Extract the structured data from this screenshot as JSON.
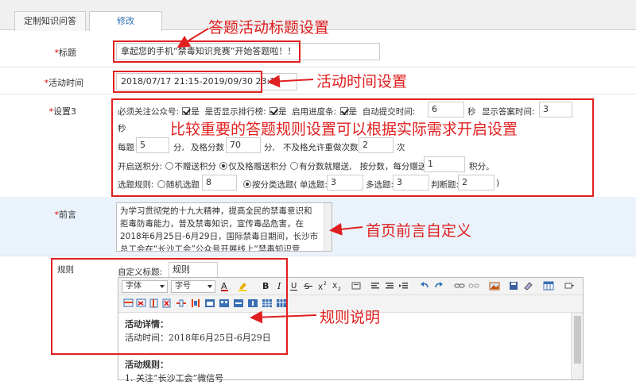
{
  "tabs": [
    {
      "label": "定制知识问答"
    },
    {
      "label": "修改"
    }
  ],
  "title_row": {
    "required": "*",
    "label": "标题",
    "value": "拿起您的手机“禁毒知识竞赛”开始答题啦！！"
  },
  "time_row": {
    "required": "*",
    "label": "活动时间",
    "value": "2018/07/17 21:15-2019/09/30 23:15"
  },
  "settings_row": {
    "required": "*",
    "label": "设置3",
    "follow_label": "必须关注公众号:",
    "follow_checked": "是",
    "rank_label": "是否显示排行榜:",
    "rank_checked": "是",
    "progress_label": "启用进度条:",
    "progress_checked": "是",
    "autosubmit_label": "自动提交时间:",
    "autosubmit_value": "6",
    "autosubmit_unit": "秒",
    "showanswer_label": "显示答案时间:",
    "showanswer_value": "3",
    "showanswer_unit": "秒",
    "score_label": "每题",
    "score_value": "5",
    "score_unit": "分,",
    "pass_label": "及格分数",
    "pass_value": "70",
    "pass_unit": "分,",
    "retry_label": "不及格允许重做次数",
    "retry_value": "2",
    "retry_unit": "次",
    "points_label": "开启送积分:",
    "points_opt1": "不赠送积分",
    "points_opt2": "仅及格赠送积分",
    "points_opt3": "有分数就赠送,",
    "points_per_label": "按分数，每分赠送",
    "points_per_value": "1",
    "points_per_unit": "积分。",
    "rule_label": "选题规则:",
    "rule_opt1": "随机选题",
    "rule_random_value": "8",
    "rule_opt2": "按分类选题( 单选题:",
    "single_value": "3",
    "multi_label": "多选题:",
    "multi_value": "3",
    "judge_label": "判断题:",
    "judge_value": "2",
    "rule_close": ")"
  },
  "preface_row": {
    "required": "*",
    "label": "前言",
    "lines": [
      "为学习贯彻党的十九大精神，提高全民的禁毒意识和",
      "拒毒防毒能力，普及禁毒知识，宣传毒品危害，在",
      "2018年6月25日-6月29日，国际禁毒日期间，长沙市",
      "总工会在“长沙工会”公众号开展线上“禁毒知识竞"
    ]
  },
  "rules_row": {
    "label": "规则",
    "custom_title_label": "自定义标题:",
    "custom_title_value": "规则",
    "font_select": "字体",
    "size_select": "字号",
    "content": [
      {
        "text": "活动详情：",
        "bold": true
      },
      {
        "text": "活动时间：2018年6月25日-6月29日",
        "bold": false
      },
      {
        "text": "",
        "bold": false
      },
      {
        "text": "活动规则：",
        "bold": true
      },
      {
        "text": "1. 关注“长沙工会”微信号",
        "bold": false
      }
    ]
  },
  "annotations": {
    "title_note": "答题活动标题设置",
    "time_note": "活动时间设置",
    "settings_note": "比较重要的答题规则设置可以根据实际需求开启设置",
    "preface_note": "首页前言自定义",
    "rules_note": "规则说明"
  },
  "colors": {
    "annotation": "#e02020",
    "tab_active": "#2a6fb4",
    "band": "#eaf3fb"
  }
}
